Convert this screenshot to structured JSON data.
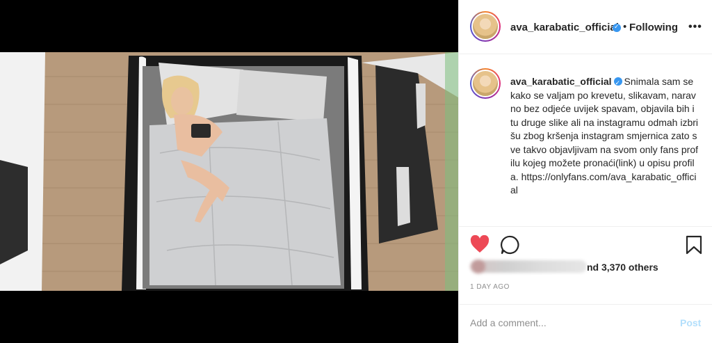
{
  "post": {
    "username": "ava_karabatic_official",
    "follow_separator": "•",
    "follow_status": "Following",
    "more_glyph": "•••",
    "caption": "Snimala sam se kako se valjam po krevetu, slikavam, naravno bez odjeće uvijek spavam, objavila bih i tu druge slike ali na instagramu odmah izbrišu zbog kršenja instagram smjernica zato sve takvo objavljivam na svom only fans profilu kojeg možete pronaći(link) u opisu profila. https://onlyfans.com/ava_karabatic_official",
    "likes_text": "nd 3,370 others",
    "timestamp": "1 DAY AGO",
    "comment_placeholder": "Add a comment...",
    "post_label": "Post"
  },
  "icons": {
    "like": "heart-icon",
    "comment": "comment-icon",
    "save": "bookmark-icon",
    "verified": "verified-badge-icon",
    "more": "more-options-icon"
  },
  "colors": {
    "like_red": "#ed4956",
    "verified_blue": "#3897f0",
    "post_disabled": "#b2dffc",
    "muted_text": "#8e8e8e"
  }
}
